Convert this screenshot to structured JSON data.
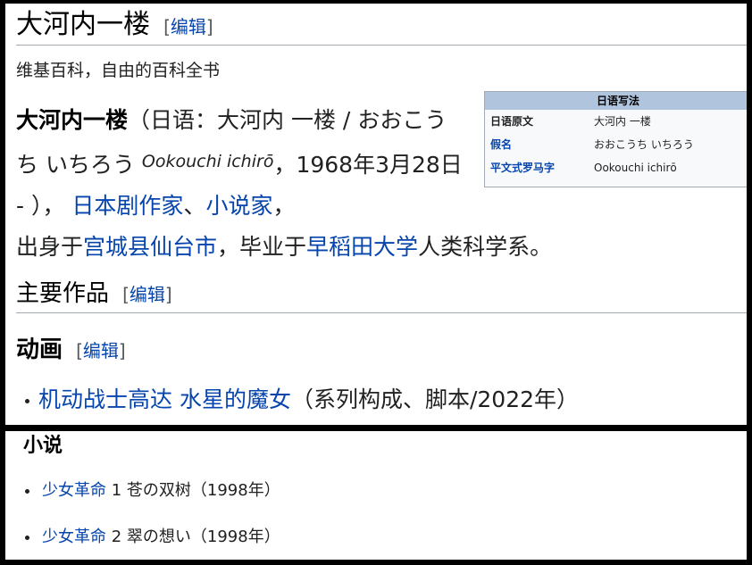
{
  "page": {
    "title": "大河内一楼",
    "edit_label": "编辑",
    "tagline": "维基百科，自由的百科全书"
  },
  "lead": {
    "name": "大河内一楼",
    "paren_open": "（日语：",
    "ja_name": "大河内 一楼",
    "slash": " / ",
    "kana": "おおこうち いちろう",
    "romaji": "Ookouchi ichirō",
    "birth": "，1968年3月28日 - ），",
    "link_screenwriter": "日本剧作家",
    "sep": "、",
    "link_novelist": "小说家",
    "comma": "，",
    "born_prefix": "出身于",
    "link_city": "宫城县仙台市",
    "grad_prefix": "，毕业于",
    "link_university": "早稻田大学",
    "dept": "人类科学系。"
  },
  "infobox": {
    "header": "日语写法",
    "rows": [
      {
        "key": "日语原文",
        "value": "大河内 一楼"
      },
      {
        "key": "假名",
        "value": "おおこうち いちろう"
      },
      {
        "key": "平文式罗马字",
        "value": "Ookouchi ichirō"
      }
    ]
  },
  "sections": {
    "works": "主要作品",
    "anime": "动画",
    "novel": "小说"
  },
  "anime_items": [
    {
      "link": "机动战士高达 水星的魔女",
      "note": "（系列构成、脚本/2022年）"
    }
  ],
  "novel_items": [
    {
      "link": "少女革命",
      "note": " 1 苍の双树（1998年）"
    },
    {
      "link": "少女革命",
      "note": " 2 翠の想い（1998年）"
    }
  ]
}
